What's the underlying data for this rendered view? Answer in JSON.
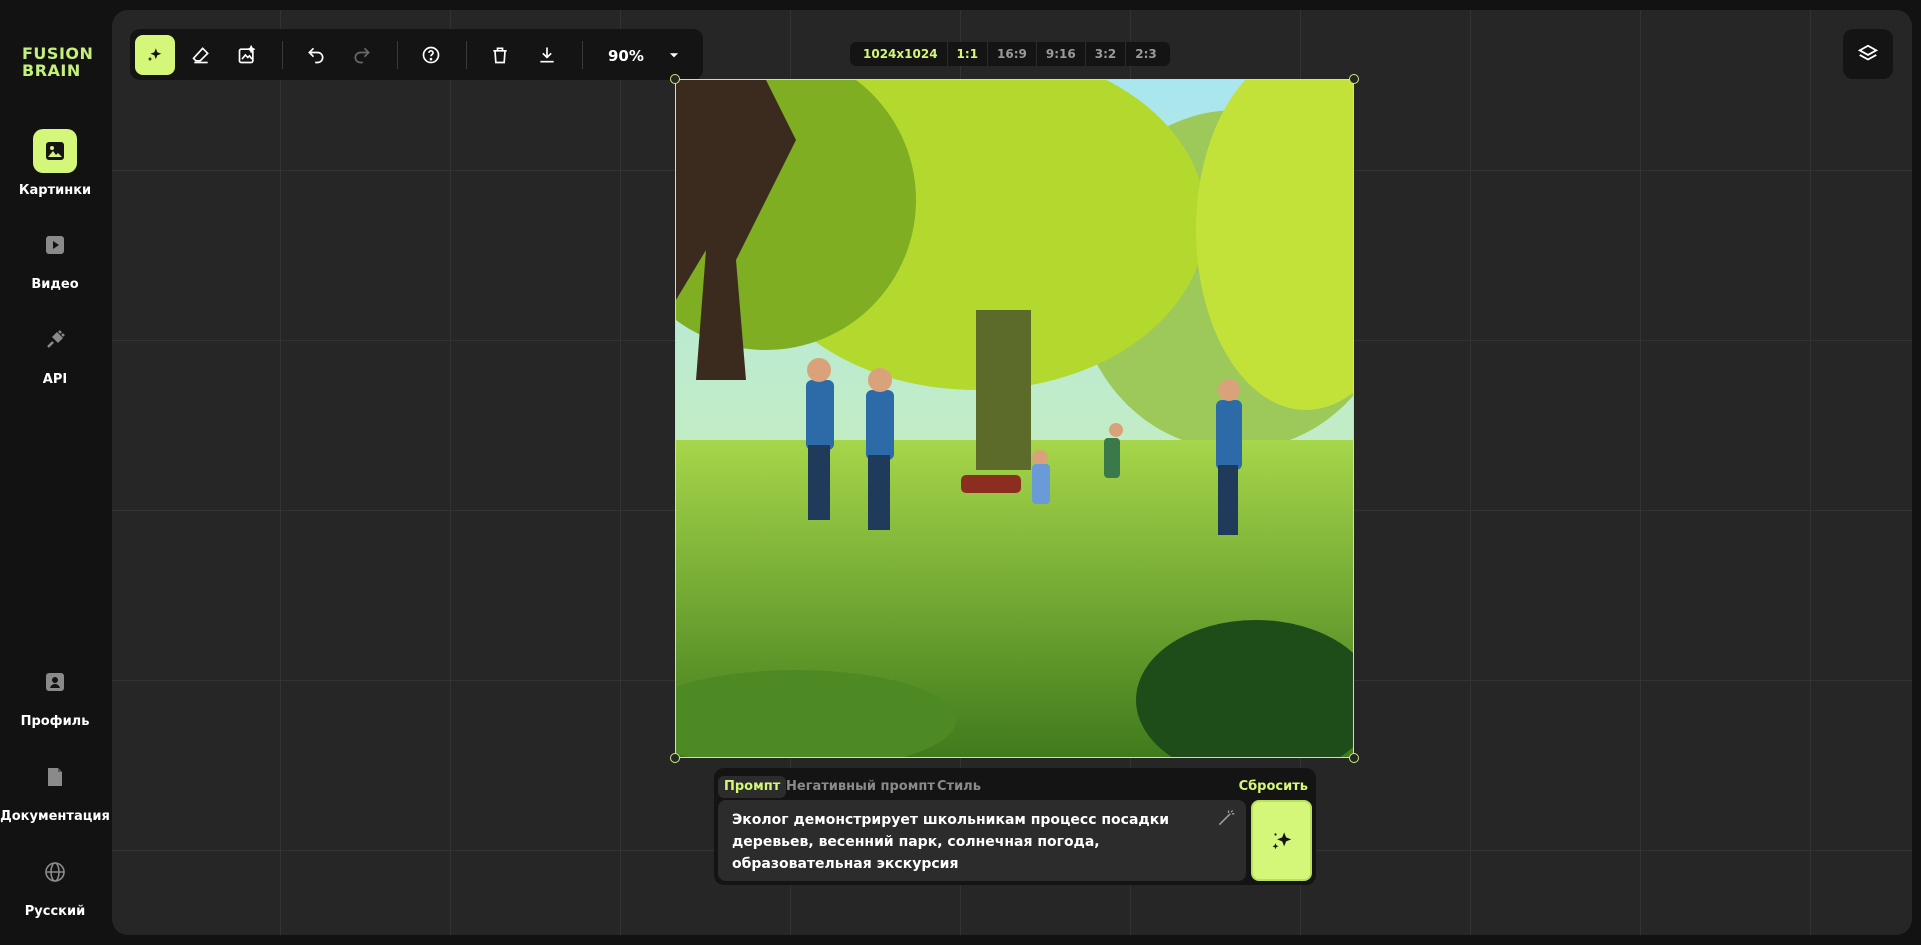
{
  "brand": {
    "line1": "FUSION",
    "line2": "BRAIN"
  },
  "nav": {
    "images": "Картинки",
    "video": "Видео",
    "api": "API",
    "profile": "Профиль",
    "docs": "Документация",
    "language": "Русский"
  },
  "toolbar": {
    "zoom": "90%",
    "icons": [
      "sparkle-icon",
      "eraser-icon",
      "image-edit-icon",
      "undo-icon",
      "redo-icon",
      "help-icon",
      "trash-icon",
      "download-icon",
      "chevron-down-icon"
    ]
  },
  "ratios": {
    "size": "1024x1024",
    "options": [
      "1:1",
      "16:9",
      "9:16",
      "3:2",
      "2:3"
    ],
    "selected": "1:1"
  },
  "prompt": {
    "tabs": {
      "prompt": "Промпт",
      "negative": "Негативный промпт",
      "style": "Стиль"
    },
    "reset": "Сбросить",
    "text": "Эколог демонстрирует школьникам процесс посадки деревьев, весенний парк, солнечная погода, образовательная экскурсия"
  },
  "colors": {
    "accent": "#d4f779",
    "canvas": "#262626",
    "background": "#121212"
  }
}
